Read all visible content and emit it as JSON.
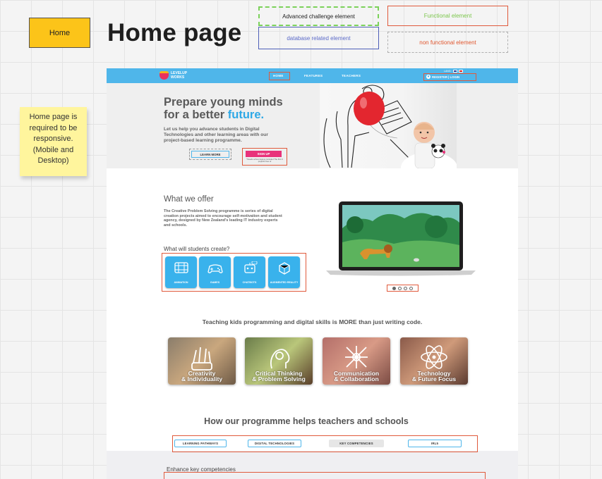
{
  "board": {
    "home_sticky": "Home",
    "page_title": "Home page",
    "note": "Home page is required to be responsive. (Mobile and Desktop)",
    "legend": {
      "advanced": "Advanced challenge element",
      "functional": "Functional element",
      "database": "database related element",
      "non_functional": "non functional element"
    },
    "colors": {
      "functional": "#e05a3c",
      "advanced": "#7bd15a",
      "database": "#4e5fb8",
      "sticky": "#fcc419",
      "note": "#fff59d"
    }
  },
  "mockup": {
    "logo": {
      "line1": "LEVELUP",
      "line2": "WORKS"
    },
    "nav": {
      "home": "HOME",
      "features": "FEATURES",
      "teachers": "TEACHERS",
      "register": "REGISTER | LOGIN",
      "lang": "LANG:"
    },
    "hero": {
      "title_line1": "Prepare young minds",
      "title_line2_prefix": "for a better",
      "title_line2_highlight": "future.",
      "body": "Let us help you advance students in Digital Technologies and other learning areas with our project-based learning programme.",
      "learn_more": "LEARN MORE",
      "sign_up": "SIGN UP",
      "sign_note": "*Needs school signup included The first 3 projects free of"
    },
    "offer": {
      "heading": "What we offer",
      "body": "The Creative Problem Solving programme is series of digital creation projects aimed to encourage self-motivation and student agency, designed by New Zealand's leading IT industry experts and schools.",
      "create_heading": "What will students create?",
      "tiles": [
        {
          "label": "ANIMATION",
          "icon": "film-icon"
        },
        {
          "label": "GAMES",
          "icon": "gamepad-icon"
        },
        {
          "label": "CHATBOTS",
          "icon": "chatbot-icon"
        },
        {
          "label": "AUGMENTED REALITY",
          "icon": "ar-icon"
        }
      ]
    },
    "tagline": "Teaching kids programming and digital skills is MORE than just writing code.",
    "cards": [
      {
        "line1": "Creativity",
        "line2": "& Individuality"
      },
      {
        "line1": "Critical Thinking",
        "line2": "& Problem Solving"
      },
      {
        "line1": "Communication",
        "line2": "& Collaboration"
      },
      {
        "line1": "Technology",
        "line2": "& Future Focus"
      }
    ],
    "how_heading": "How our programme helps teachers and schools",
    "tabs": [
      "LEARNING PATHWAYS",
      "DIGITAL TECHNOLOGIES",
      "KEY COMPETENCIES",
      "IRL5"
    ],
    "enhance_heading": "Enhance key competencies"
  }
}
